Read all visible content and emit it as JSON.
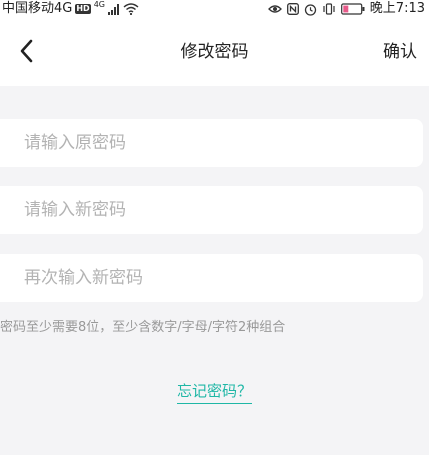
{
  "status_bar": {
    "carrier": "中国移动4G",
    "hd_badge": "HD",
    "network_type": "4G",
    "time_label": "晚上7:13"
  },
  "nav": {
    "title": "修改密码",
    "confirm_label": "确认"
  },
  "form": {
    "old_password_placeholder": "请输入原密码",
    "new_password_placeholder": "请输入新密码",
    "confirm_password_placeholder": "再次输入新密码",
    "hint": "密码至少需要8位，至少含数字/字母/字符2种组合"
  },
  "forgot_password_label": "忘记密码？",
  "colors": {
    "accent": "#1fb7a6",
    "background": "#f4f4f6",
    "placeholder": "#b3b3b3",
    "hint": "#999999"
  }
}
